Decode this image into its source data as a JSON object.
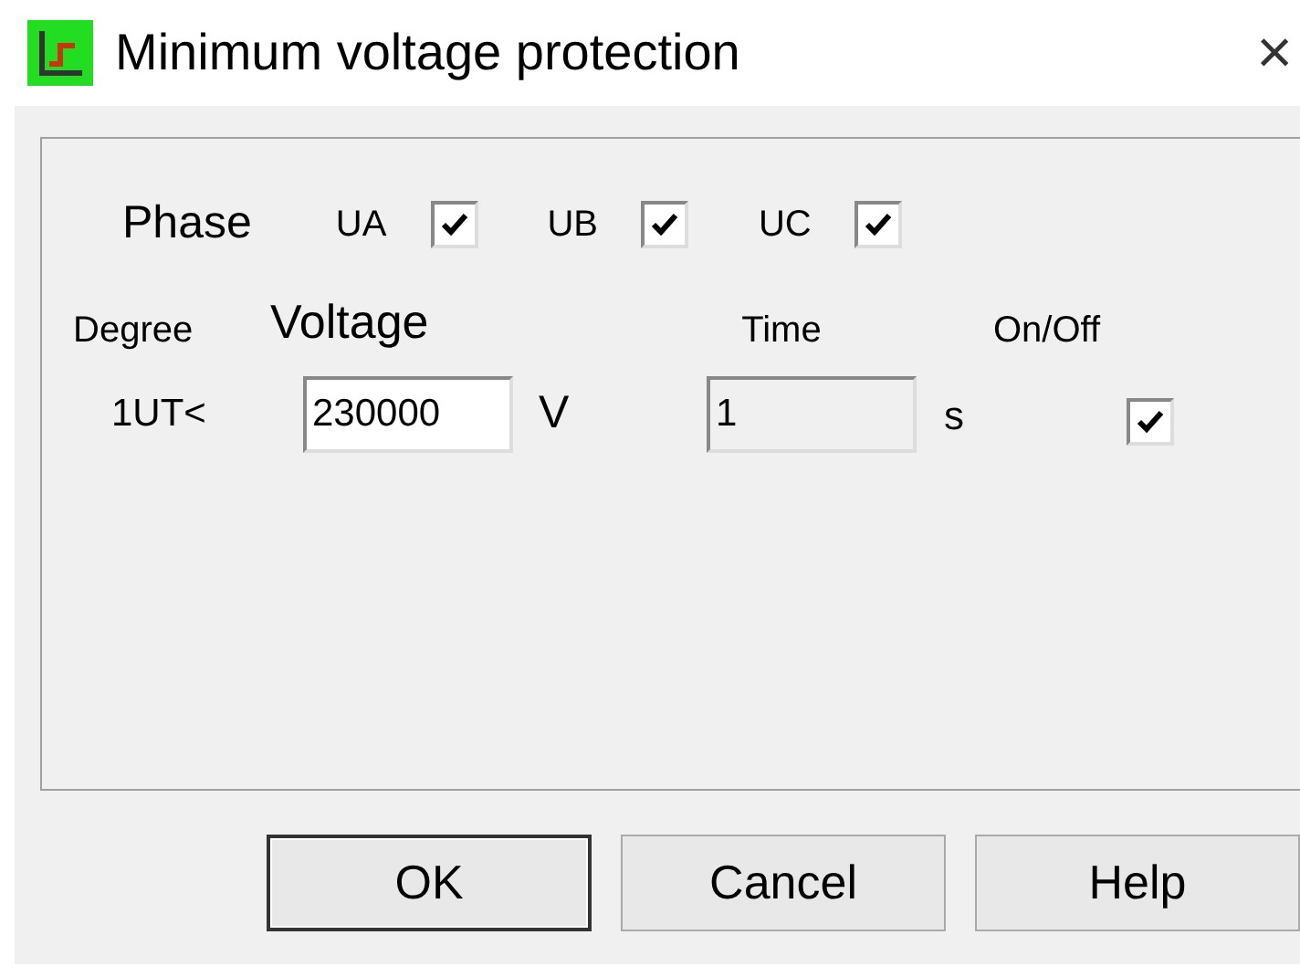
{
  "window": {
    "title": "Minimum voltage protection",
    "close": "×"
  },
  "phase": {
    "label": "Phase",
    "items": [
      {
        "label": "UA",
        "checked": true
      },
      {
        "label": "UB",
        "checked": true
      },
      {
        "label": "UC",
        "checked": true
      }
    ]
  },
  "columns": [
    "Degree",
    "Voltage",
    "Time",
    "On/Off"
  ],
  "rows": [
    {
      "degree": "1UT<",
      "voltage": "230000",
      "voltage_unit": "V",
      "time": "1",
      "time_unit": "s",
      "time_disabled": true,
      "on": true
    }
  ],
  "buttons": [
    {
      "label": "OK",
      "default": true
    },
    {
      "label": "Cancel",
      "default": false
    },
    {
      "label": "Help",
      "default": false
    }
  ]
}
